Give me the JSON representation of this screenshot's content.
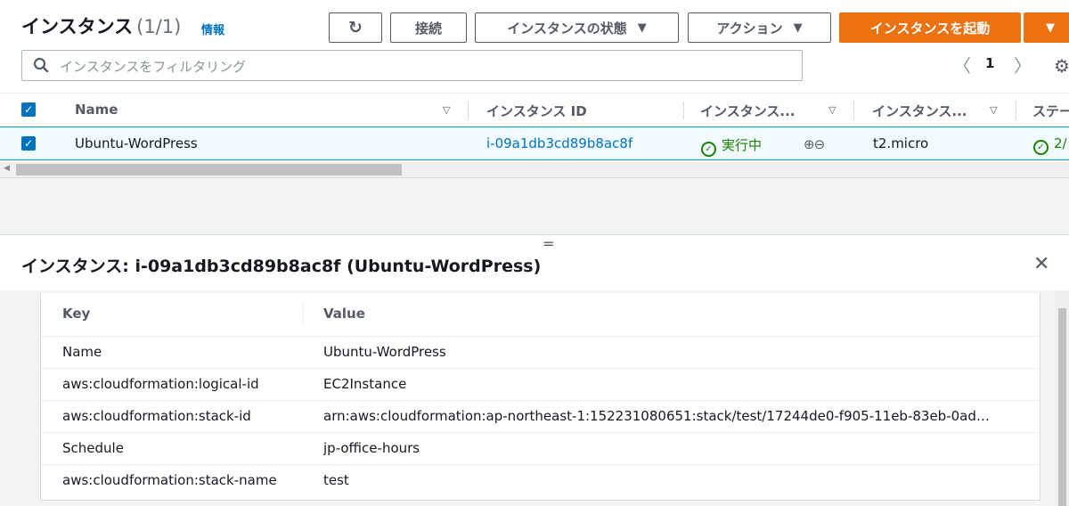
{
  "header": {
    "title": "インスタンス",
    "count": "(1/1)",
    "info_link": "情報"
  },
  "toolbar": {
    "refresh_icon": "↻",
    "connect_label": "接続",
    "instance_state_label": "インスタンスの状態",
    "actions_label": "アクション",
    "launch_label": "インスタンスを起動",
    "caret": "▼"
  },
  "search": {
    "placeholder": "インスタンスをフィルタリング"
  },
  "pager": {
    "prev": "〈",
    "page": "1",
    "next": "〉"
  },
  "table": {
    "columns": [
      "Name",
      "インスタンス ID",
      "インスタンス...",
      "インスタンス...",
      "ステー"
    ],
    "rows": [
      {
        "name": "Ubuntu-WordPress",
        "instance_id": "i-09a1db3cd89b8ac8f",
        "state": "実行中",
        "type": "t2.micro",
        "status_check": "2/"
      }
    ]
  },
  "detail": {
    "title": "インスタンス: i-09a1db3cd89b8ac8f (Ubuntu-WordPress)",
    "drag_handle": "=",
    "close_icon": "✕",
    "tags": {
      "key_header": "Key",
      "value_header": "Value",
      "rows": [
        {
          "key": "Name",
          "value": "Ubuntu-WordPress"
        },
        {
          "key": "aws:cloudformation:logical-id",
          "value": "EC2Instance"
        },
        {
          "key": "aws:cloudformation:stack-id",
          "value": "arn:aws:cloudformation:ap-northeast-1:152231080651:stack/test/17244de0-f905-11eb-83eb-0ad…"
        },
        {
          "key": "Schedule",
          "value": "jp-office-hours"
        },
        {
          "key": "aws:cloudformation:stack-name",
          "value": "test"
        }
      ]
    }
  },
  "colors": {
    "primary_orange": "#ec7211",
    "link_blue": "#0073bb",
    "success_green": "#1d8102",
    "selected_row_bg": "#f1faff"
  }
}
